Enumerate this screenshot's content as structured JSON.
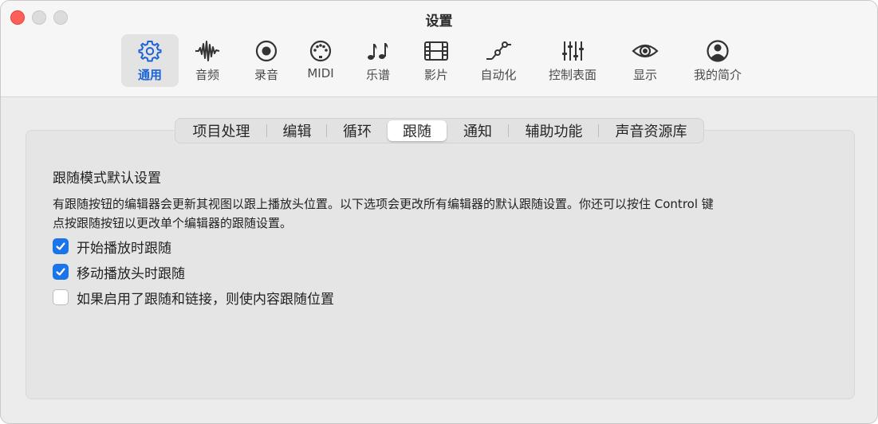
{
  "window": {
    "title": "设置"
  },
  "toolbar": {
    "items": [
      {
        "label": "通用",
        "icon": "gear-icon",
        "active": true
      },
      {
        "label": "音频",
        "icon": "waveform-icon"
      },
      {
        "label": "录音",
        "icon": "record-icon"
      },
      {
        "label": "MIDI",
        "icon": "midi-port-icon"
      },
      {
        "label": "乐谱",
        "icon": "music-notes-icon"
      },
      {
        "label": "影片",
        "icon": "film-icon"
      },
      {
        "label": "自动化",
        "icon": "automation-icon"
      },
      {
        "label": "控制表面",
        "icon": "sliders-icon"
      },
      {
        "label": "显示",
        "icon": "eye-icon"
      },
      {
        "label": "我的简介",
        "icon": "person-circle-icon"
      }
    ],
    "accent_color": "#1a63d8"
  },
  "tabs": {
    "items": [
      "项目处理",
      "编辑",
      "循环",
      "跟随",
      "通知",
      "辅助功能",
      "声音资源库"
    ],
    "selected": "跟随"
  },
  "section": {
    "title": "跟随模式默认设置",
    "description_line1": "有跟随按钮的编辑器会更新其视图以跟上播放头位置。以下选项会更改所有编辑器的默认跟随设置。你还可以按住 Control 键",
    "description_line2": "点按跟随按钮以更改单个编辑器的跟随设置。"
  },
  "options": [
    {
      "label": "开始播放时跟随",
      "checked": true
    },
    {
      "label": "移动播放头时跟随",
      "checked": true
    },
    {
      "label": "如果启用了跟随和链接，则使内容跟随位置",
      "checked": false
    }
  ],
  "colors": {
    "checkbox_on": "#1b74e8",
    "close_button": "#fe5f57"
  }
}
